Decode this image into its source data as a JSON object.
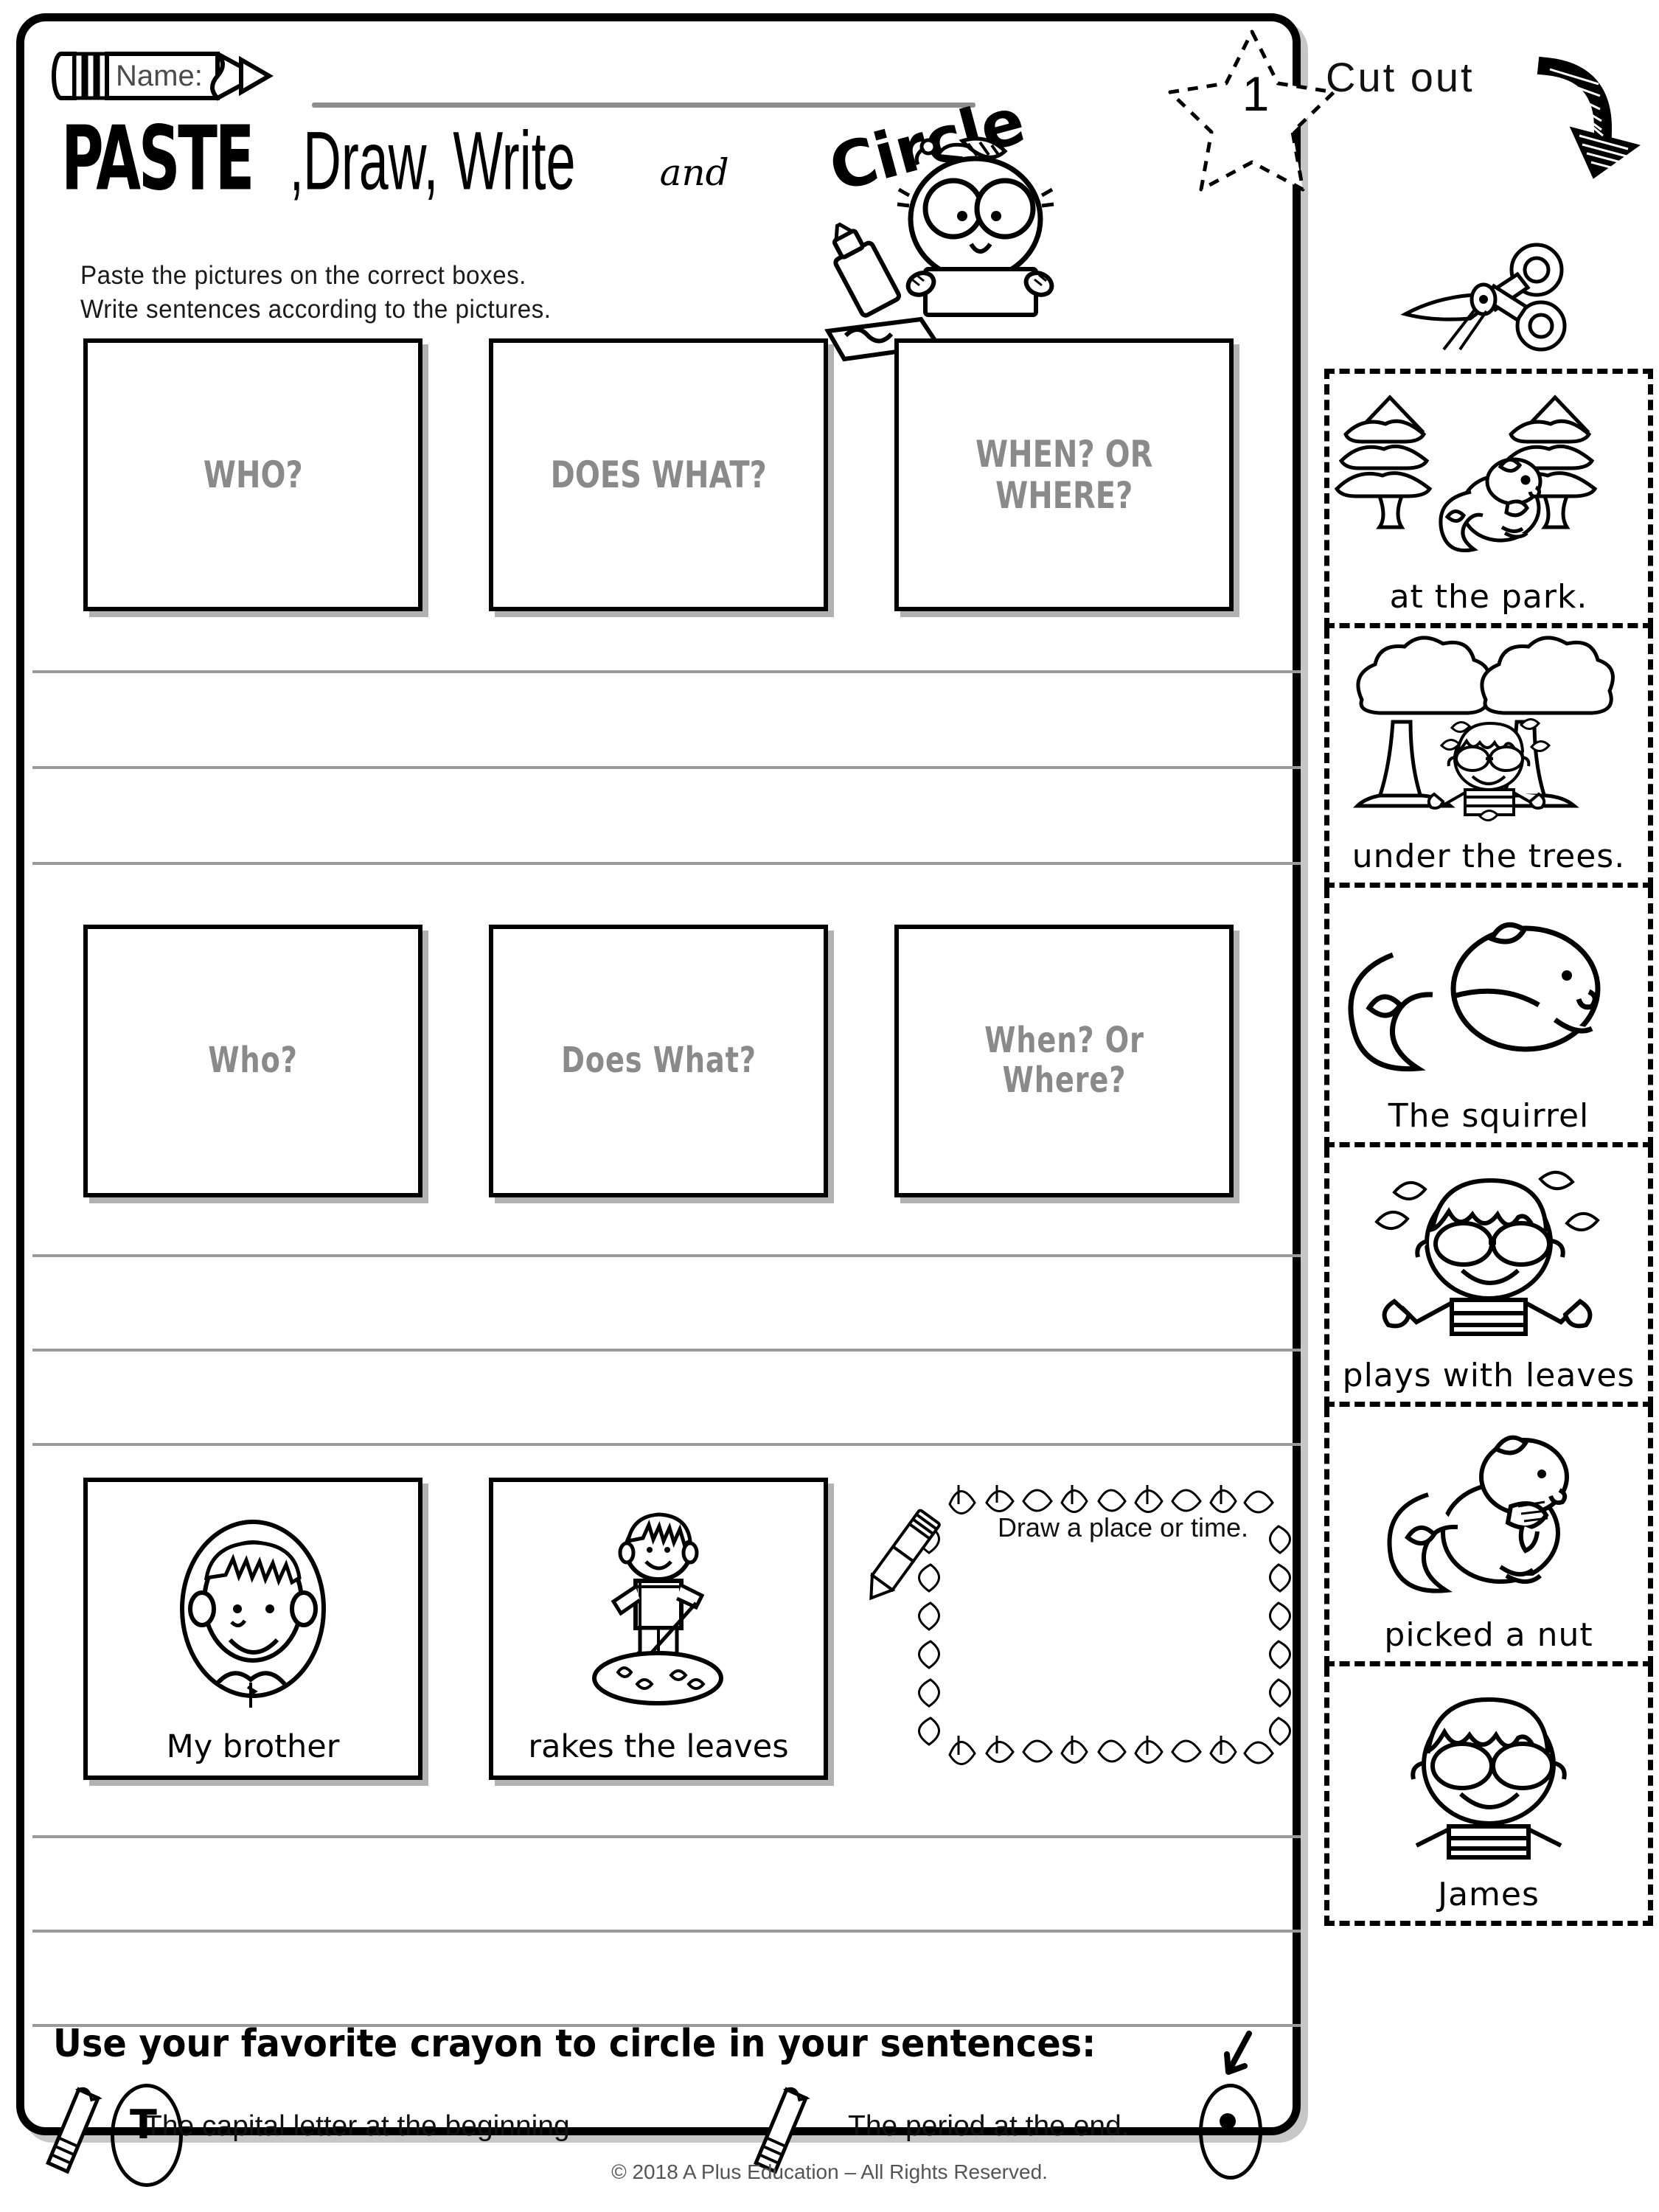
{
  "header": {
    "name_label": "Name:",
    "star_number": "1"
  },
  "title": {
    "word1": "PASTE",
    "comma1": ",",
    "word2": "Draw, Write",
    "connector": "and",
    "word3": "Circle"
  },
  "subtitle": {
    "line1": "Paste the pictures on the correct boxes.",
    "line2": "Write sentences according to the pictures."
  },
  "prompt_rows": [
    {
      "style": "caps",
      "boxes": [
        "WHO?",
        "DOES WHAT?",
        "WHEN? OR WHERE?"
      ]
    },
    {
      "style": "mixed",
      "boxes": [
        "Who?",
        "Does What?",
        "When? Or Where?"
      ]
    }
  ],
  "answer_row": {
    "cards": [
      {
        "caption": "My brother",
        "picture": "boy-face-icon"
      },
      {
        "caption": "rakes the leaves",
        "picture": "boy-raking-leaves-icon"
      }
    ],
    "draw_box_label": "Draw a place or time."
  },
  "bottom": {
    "heading": "Use your favorite crayon to circle in your sentences:",
    "item1": "The capital letter at the beginning",
    "item2": "The period at the end.",
    "copyright": "© 2018 A Plus Education – All Rights Reserved."
  },
  "cutout": {
    "title": "Cut out",
    "arrow_icon": "curved-arrow-down-icon",
    "scissors_icon": "scissors-icon",
    "cards": [
      {
        "caption": "at the park.",
        "picture": "two-pine-trees-with-squirrel-icon"
      },
      {
        "caption": "under the trees.",
        "picture": "two-trees-with-boy-icon"
      },
      {
        "caption": "The squirrel",
        "picture": "squirrel-icon"
      },
      {
        "caption": "plays with leaves",
        "picture": "boy-with-leaves-icon"
      },
      {
        "caption": "picked a nut",
        "picture": "squirrel-holding-nut-icon"
      },
      {
        "caption": "James",
        "picture": "boy-with-glasses-icon"
      }
    ]
  },
  "colors": {
    "ink": "#000000",
    "prompt_text": "#8a8a8a",
    "rule_line": "#9a9a9a"
  }
}
